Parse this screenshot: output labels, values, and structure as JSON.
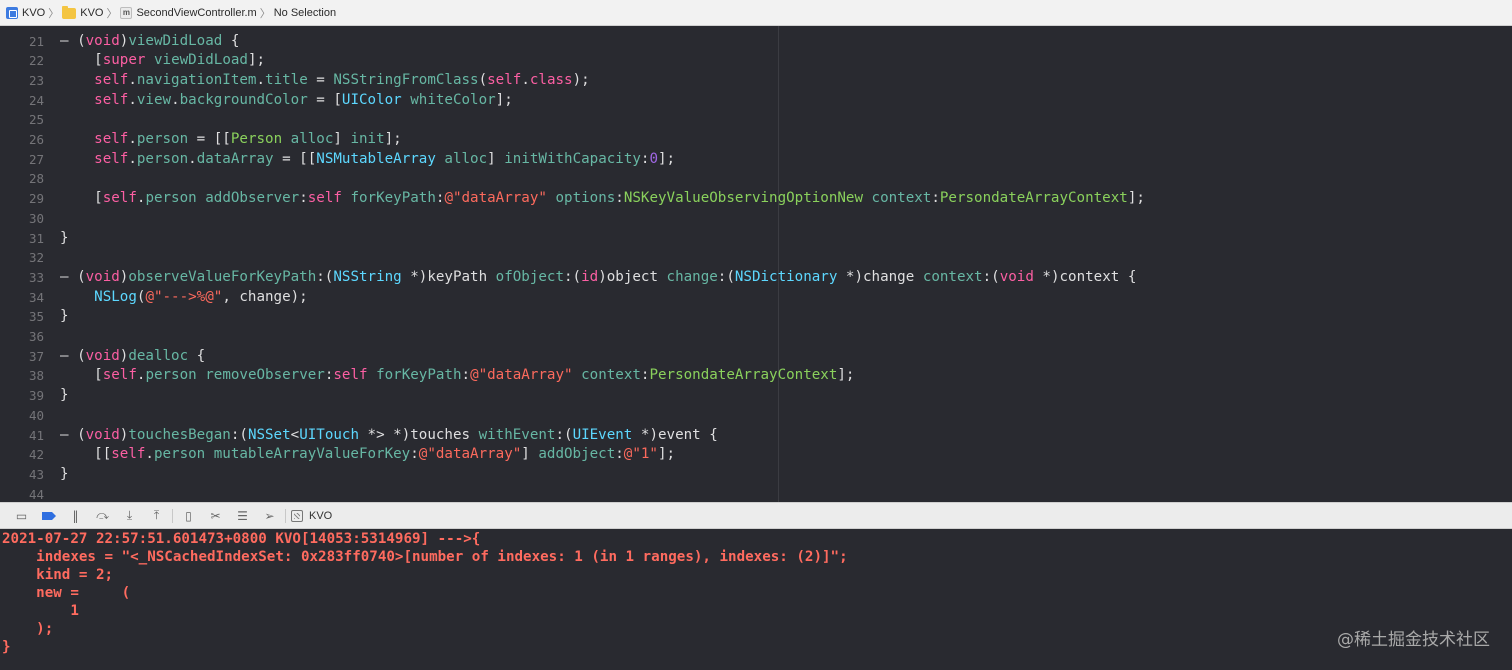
{
  "breadcrumb": {
    "items": [
      "KVO",
      "KVO",
      "SecondViewController.m",
      "No Selection"
    ],
    "file_badge": "m"
  },
  "editor": {
    "lines": [
      {
        "n": "21",
        "tokens": [
          [
            "p",
            "– ("
          ],
          [
            "kw",
            "void"
          ],
          [
            "p",
            ")"
          ],
          [
            "fn",
            "viewDidLoad"
          ],
          [
            "p",
            " {"
          ]
        ]
      },
      {
        "n": "22",
        "tokens": [
          [
            "p",
            "    ["
          ],
          [
            "kw",
            "super"
          ],
          [
            "p",
            " "
          ],
          [
            "fn",
            "viewDidLoad"
          ],
          [
            "p",
            "];"
          ]
        ]
      },
      {
        "n": "23",
        "tokens": [
          [
            "p",
            "    "
          ],
          [
            "kw",
            "self"
          ],
          [
            "p",
            "."
          ],
          [
            "fn",
            "navigationItem"
          ],
          [
            "p",
            "."
          ],
          [
            "fn",
            "title"
          ],
          [
            "p",
            " = "
          ],
          [
            "fn",
            "NSStringFromClass"
          ],
          [
            "p",
            "("
          ],
          [
            "kw",
            "self"
          ],
          [
            "p",
            "."
          ],
          [
            "kw",
            "class"
          ],
          [
            "p",
            ");"
          ]
        ]
      },
      {
        "n": "24",
        "tokens": [
          [
            "p",
            "    "
          ],
          [
            "kw",
            "self"
          ],
          [
            "p",
            "."
          ],
          [
            "fn",
            "view"
          ],
          [
            "p",
            "."
          ],
          [
            "fn",
            "backgroundColor"
          ],
          [
            "p",
            " = ["
          ],
          [
            "ty",
            "UIColor"
          ],
          [
            "p",
            " "
          ],
          [
            "fn",
            "whiteColor"
          ],
          [
            "p",
            "];"
          ]
        ]
      },
      {
        "n": "25",
        "tokens": []
      },
      {
        "n": "26",
        "tokens": [
          [
            "p",
            "    "
          ],
          [
            "kw",
            "self"
          ],
          [
            "p",
            "."
          ],
          [
            "fn",
            "person"
          ],
          [
            "p",
            " = [["
          ],
          [
            "gn",
            "Person"
          ],
          [
            "p",
            " "
          ],
          [
            "fn",
            "alloc"
          ],
          [
            "p",
            "] "
          ],
          [
            "fn",
            "init"
          ],
          [
            "p",
            "];"
          ]
        ]
      },
      {
        "n": "27",
        "tokens": [
          [
            "p",
            "    "
          ],
          [
            "kw",
            "self"
          ],
          [
            "p",
            "."
          ],
          [
            "fn",
            "person"
          ],
          [
            "p",
            "."
          ],
          [
            "fn",
            "dataArray"
          ],
          [
            "p",
            " = [["
          ],
          [
            "ty",
            "NSMutableArray"
          ],
          [
            "p",
            " "
          ],
          [
            "fn",
            "alloc"
          ],
          [
            "p",
            "] "
          ],
          [
            "fn",
            "initWithCapacity"
          ],
          [
            "p",
            ":"
          ],
          [
            "pr",
            "0"
          ],
          [
            "p",
            "];"
          ]
        ]
      },
      {
        "n": "28",
        "tokens": []
      },
      {
        "n": "29",
        "tokens": [
          [
            "p",
            "    ["
          ],
          [
            "kw",
            "self"
          ],
          [
            "p",
            "."
          ],
          [
            "fn",
            "person"
          ],
          [
            "p",
            " "
          ],
          [
            "fn",
            "addObserver"
          ],
          [
            "p",
            ":"
          ],
          [
            "kw",
            "self"
          ],
          [
            "p",
            " "
          ],
          [
            "fn",
            "forKeyPath"
          ],
          [
            "p",
            ":"
          ],
          [
            "st",
            "@\"dataArray\""
          ],
          [
            "p",
            " "
          ],
          [
            "fn",
            "options"
          ],
          [
            "p",
            ":"
          ],
          [
            "gn",
            "NSKeyValueObservingOptionNew"
          ],
          [
            "p",
            " "
          ],
          [
            "fn",
            "context"
          ],
          [
            "p",
            ":"
          ],
          [
            "gn",
            "PersondateArrayContext"
          ],
          [
            "p",
            "];"
          ]
        ]
      },
      {
        "n": "30",
        "tokens": []
      },
      {
        "n": "31",
        "tokens": [
          [
            "p",
            "}"
          ]
        ]
      },
      {
        "n": "32",
        "tokens": []
      },
      {
        "n": "33",
        "tokens": [
          [
            "p",
            "– ("
          ],
          [
            "kw",
            "void"
          ],
          [
            "p",
            ")"
          ],
          [
            "fn",
            "observeValueForKeyPath"
          ],
          [
            "p",
            ":("
          ],
          [
            "ty",
            "NSString"
          ],
          [
            "p",
            " *)keyPath "
          ],
          [
            "fn",
            "ofObject"
          ],
          [
            "p",
            ":("
          ],
          [
            "kw",
            "id"
          ],
          [
            "p",
            ")object "
          ],
          [
            "fn",
            "change"
          ],
          [
            "p",
            ":("
          ],
          [
            "ty",
            "NSDictionary"
          ],
          [
            "p",
            " *)change "
          ],
          [
            "fn",
            "context"
          ],
          [
            "p",
            ":("
          ],
          [
            "kw",
            "void"
          ],
          [
            "p",
            " *)context {"
          ]
        ]
      },
      {
        "n": "34",
        "tokens": [
          [
            "p",
            "    "
          ],
          [
            "ty",
            "NSLog"
          ],
          [
            "p",
            "("
          ],
          [
            "st",
            "@\"--->%@\""
          ],
          [
            "p",
            ", change);"
          ]
        ]
      },
      {
        "n": "35",
        "tokens": [
          [
            "p",
            "}"
          ]
        ]
      },
      {
        "n": "36",
        "tokens": []
      },
      {
        "n": "37",
        "tokens": [
          [
            "p",
            "– ("
          ],
          [
            "kw",
            "void"
          ],
          [
            "p",
            ")"
          ],
          [
            "fn",
            "dealloc"
          ],
          [
            "p",
            " {"
          ]
        ]
      },
      {
        "n": "38",
        "tokens": [
          [
            "p",
            "    ["
          ],
          [
            "kw",
            "self"
          ],
          [
            "p",
            "."
          ],
          [
            "fn",
            "person"
          ],
          [
            "p",
            " "
          ],
          [
            "fn",
            "removeObserver"
          ],
          [
            "p",
            ":"
          ],
          [
            "kw",
            "self"
          ],
          [
            "p",
            " "
          ],
          [
            "fn",
            "forKeyPath"
          ],
          [
            "p",
            ":"
          ],
          [
            "st",
            "@\"dataArray\""
          ],
          [
            "p",
            " "
          ],
          [
            "fn",
            "context"
          ],
          [
            "p",
            ":"
          ],
          [
            "gn",
            "PersondateArrayContext"
          ],
          [
            "p",
            "];"
          ]
        ]
      },
      {
        "n": "39",
        "tokens": [
          [
            "p",
            "}"
          ]
        ]
      },
      {
        "n": "40",
        "tokens": []
      },
      {
        "n": "41",
        "tokens": [
          [
            "p",
            "– ("
          ],
          [
            "kw",
            "void"
          ],
          [
            "p",
            ")"
          ],
          [
            "fn",
            "touchesBegan"
          ],
          [
            "p",
            ":("
          ],
          [
            "ty",
            "NSSet"
          ],
          [
            "p",
            "<"
          ],
          [
            "ty",
            "UITouch"
          ],
          [
            "p",
            " *> *)touches "
          ],
          [
            "fn",
            "withEvent"
          ],
          [
            "p",
            ":("
          ],
          [
            "ty",
            "UIEvent"
          ],
          [
            "p",
            " *)event {"
          ]
        ]
      },
      {
        "n": "42",
        "tokens": [
          [
            "p",
            "    [["
          ],
          [
            "kw",
            "self"
          ],
          [
            "p",
            "."
          ],
          [
            "fn",
            "person"
          ],
          [
            "p",
            " "
          ],
          [
            "fn",
            "mutableArrayValueForKey"
          ],
          [
            "p",
            ":"
          ],
          [
            "st",
            "@\"dataArray\""
          ],
          [
            "p",
            "] "
          ],
          [
            "fn",
            "addObject"
          ],
          [
            "p",
            ":"
          ],
          [
            "st",
            "@\"1\""
          ],
          [
            "p",
            "];"
          ]
        ]
      },
      {
        "n": "43",
        "tokens": [
          [
            "p",
            "}"
          ]
        ]
      },
      {
        "n": "44",
        "tokens": []
      }
    ]
  },
  "debugbar": {
    "target_label": "KVO",
    "buttons": [
      "hide-console-icon",
      "breakpoint-icon",
      "pause-icon",
      "step-over-icon",
      "step-into-icon",
      "step-out-icon",
      "view-debugger-icon",
      "memory-graph-icon",
      "environment-icon",
      "location-icon"
    ]
  },
  "console": {
    "lines": [
      "2021-07-27 22:57:51.601473+0800 KVO[14053:5314969] --->{",
      "    indexes = \"<_NSCachedIndexSet: 0x283ff0740>[number of indexes: 1 (in 1 ranges), indexes: (2)]\";",
      "    kind = 2;",
      "    new =     (",
      "        1",
      "    );",
      "}"
    ]
  },
  "watermark": "@稀土掘金技术社区"
}
